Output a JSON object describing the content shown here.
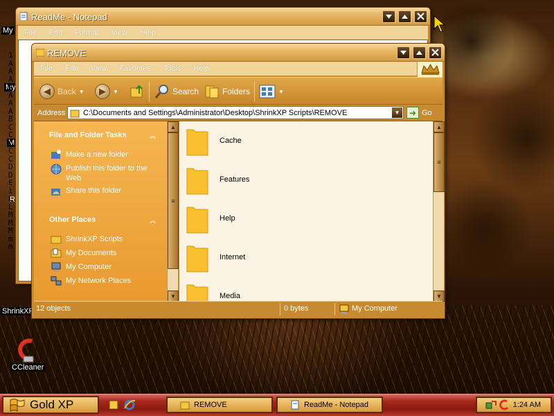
{
  "desktop": {
    "icon_labels": [
      "My",
      "My",
      "M",
      "R",
      "ShrinkXP",
      "CCleaner"
    ]
  },
  "notepad": {
    "title": "ReadMe - Notepad",
    "menu": [
      "File",
      "Edit",
      "Format",
      "View",
      "Help"
    ],
    "visible_text_column": [
      "1",
      "A",
      "A",
      "A",
      "A",
      "A",
      "A",
      "A",
      "B",
      "C",
      "C",
      "C",
      "C",
      "C",
      "D",
      "D",
      "E",
      "ì",
      "L",
      "L",
      "M",
      "M",
      "M",
      "m",
      "m"
    ]
  },
  "explorer": {
    "title": "REMOVE",
    "menu": [
      "File",
      "Edit",
      "View",
      "Favorites",
      "Tools",
      "Help"
    ],
    "toolbar": {
      "back": "Back",
      "search": "Search",
      "folders": "Folders"
    },
    "address": {
      "label": "Address",
      "path": "C:\\Documents and Settings\\Administrator\\Desktop\\ShrinkXP Scripts\\REMOVE",
      "go": "Go"
    },
    "tasks": {
      "file_folder_header": "File and Folder Tasks",
      "file_folder_items": [
        "Make a new folder",
        "Publish this folder to the Web",
        "Share this folder"
      ],
      "other_places_header": "Other Places",
      "other_places_items": [
        "ShrinkXP Scripts",
        "My Documents",
        "My Computer",
        "My Network Places"
      ]
    },
    "files": [
      "Cache",
      "Features",
      "Help",
      "Internet",
      "Media"
    ],
    "status": {
      "objects": "12 objects",
      "size": "0 bytes",
      "location": "My Computer"
    }
  },
  "taskbar": {
    "start_label": "Gold XP",
    "buttons": [
      "REMOVE",
      "ReadMe - Notepad"
    ],
    "clock": "1:24 AM"
  }
}
